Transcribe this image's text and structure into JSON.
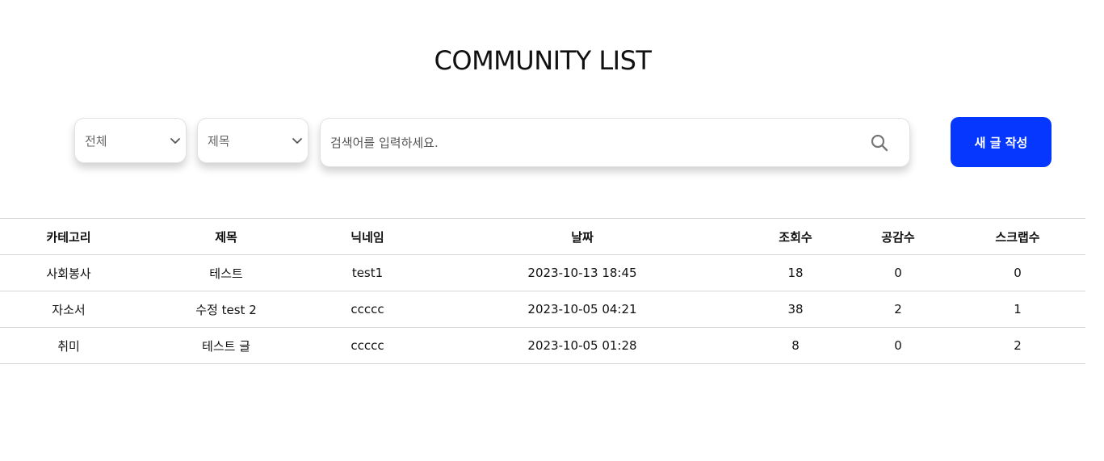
{
  "page": {
    "title": "COMMUNITY LIST"
  },
  "filters": {
    "category_select": {
      "value": "전체"
    },
    "field_select": {
      "value": "제목"
    }
  },
  "search": {
    "placeholder": "검색어를 입력하세요.",
    "value": "",
    "icon": "search-icon"
  },
  "actions": {
    "write_label": "새 글 작성",
    "write_color": "#0637ff"
  },
  "table": {
    "columns": [
      "카테고리",
      "제목",
      "닉네임",
      "날짜",
      "조회수",
      "공감수",
      "스크랩수"
    ],
    "rows": [
      [
        "사회봉사",
        "테스트",
        "test1",
        "2023-10-13 18:45",
        "18",
        "0",
        "0"
      ],
      [
        "자소서",
        "수정 test 2",
        "ccccc",
        "2023-10-05 04:21",
        "38",
        "2",
        "1"
      ],
      [
        "취미",
        "테스트 글",
        "ccccc",
        "2023-10-05 01:28",
        "8",
        "0",
        "2"
      ]
    ]
  }
}
